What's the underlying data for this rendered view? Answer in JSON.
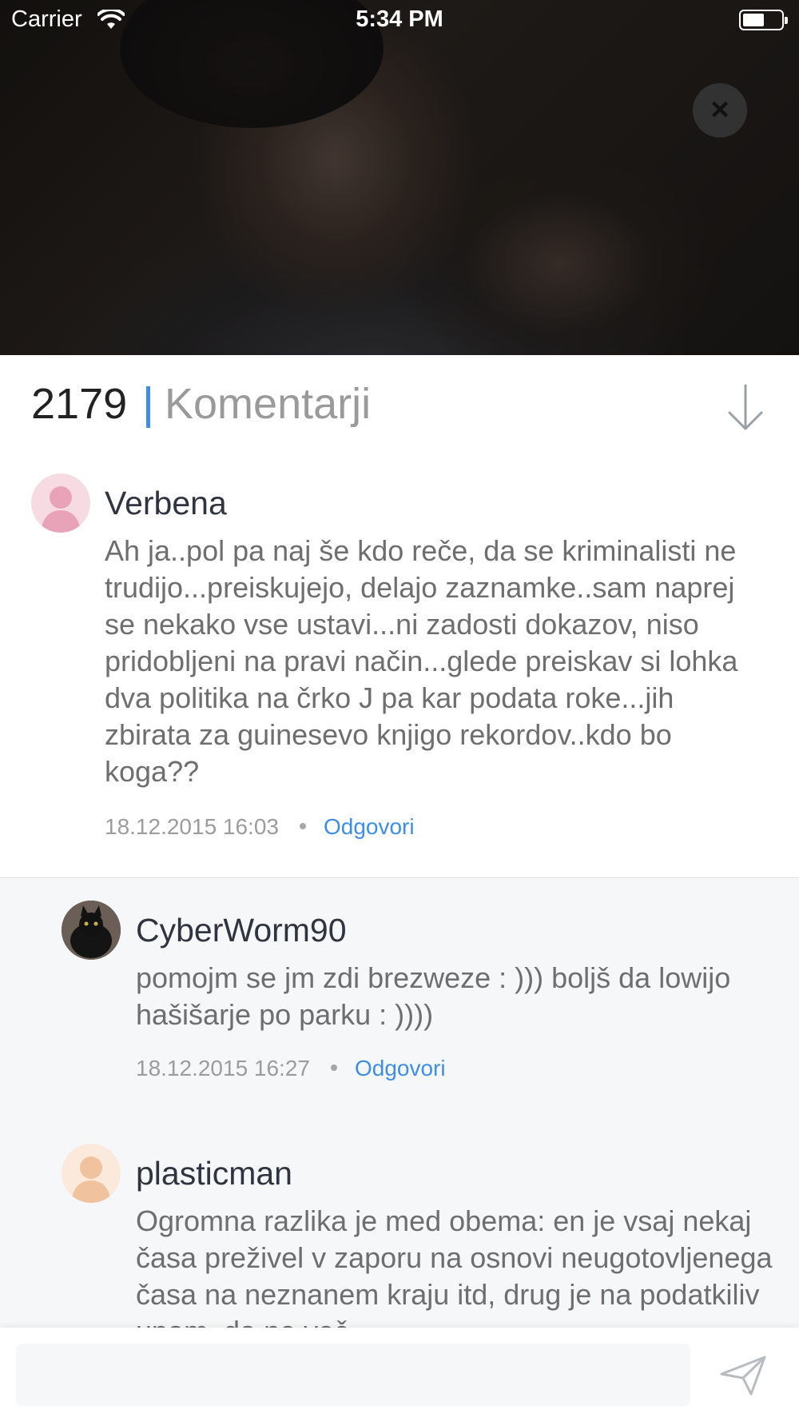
{
  "status_bar": {
    "carrier": "Carrier",
    "time": "5:34 PM"
  },
  "header": {
    "count": "2179",
    "title": "Komentarji",
    "accent_color": "#3d8ee6"
  },
  "comments": [
    {
      "author": "Verbena",
      "text": "Ah ja..pol pa naj še kdo reče, da se kriminalisti ne trudijo...preiskujejo, delajo zaznamke..sam naprej se nekako vse ustavi...ni zadosti dokazov, niso pridobljeni na pravi način...glede preiskav si lohka dva politika na črko J pa kar podata roke...jih zbirata za guinesevo knjigo rekordov..kdo bo koga??",
      "date": "18.12.2015 16:03",
      "reply_label": "Odgovori",
      "avatar_icon": "female-avatar-icon"
    },
    {
      "author": "CyberWorm90",
      "text": "pomojm se jm zdi brezweze : ))) boljš da lowijo hašišarje po parku : ))))",
      "date": "18.12.2015 16:27",
      "reply_label": "Odgovori",
      "avatar_icon": "cat-avatar-icon"
    },
    {
      "author": "plasticman",
      "text": "Ogromna razlika je med obema: en je vsaj nekaj časa preživel v zaporu na osnovi neugotovljenega časa na neznanem kraju itd, drug je na podatkiliv upam, da ne več",
      "avatar_icon": "male-avatar-icon"
    }
  ],
  "composer": {
    "placeholder": ""
  }
}
